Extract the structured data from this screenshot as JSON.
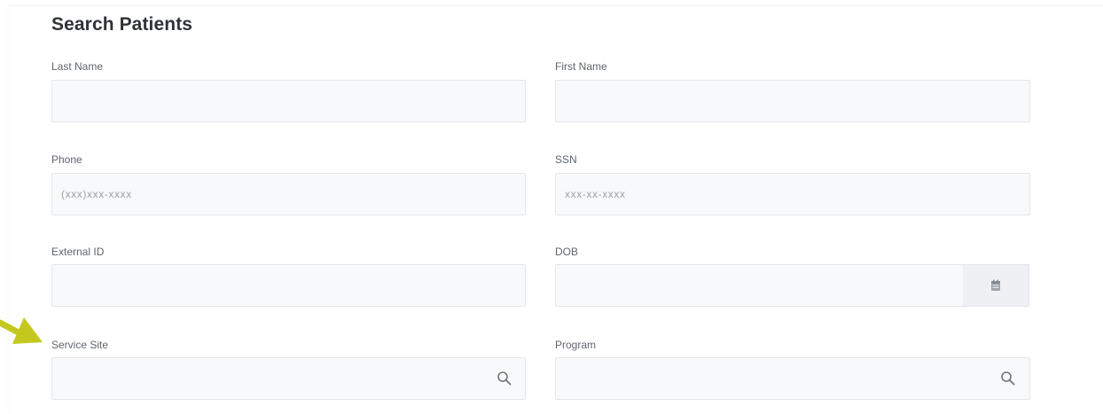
{
  "page": {
    "title": "Search Patients"
  },
  "fields": {
    "last_name": {
      "label": "Last Name",
      "value": ""
    },
    "first_name": {
      "label": "First Name",
      "value": ""
    },
    "phone": {
      "label": "Phone",
      "placeholder": "(xxx)xxx-xxxx"
    },
    "ssn": {
      "label": "SSN",
      "placeholder": "xxx-xx-xxxx"
    },
    "external_id": {
      "label": "External ID",
      "value": ""
    },
    "dob": {
      "label": "DOB",
      "value": ""
    },
    "service_site": {
      "label": "Service Site",
      "value": ""
    },
    "program": {
      "label": "Program",
      "value": ""
    }
  },
  "icons": {
    "calendar": "calendar-icon",
    "search": "search-icon",
    "annotation_arrow": "arrow-icon"
  },
  "colors": {
    "annotation_arrow": "#c4c81e",
    "input_background": "#f8f9fb",
    "title_text": "#2f3338"
  }
}
